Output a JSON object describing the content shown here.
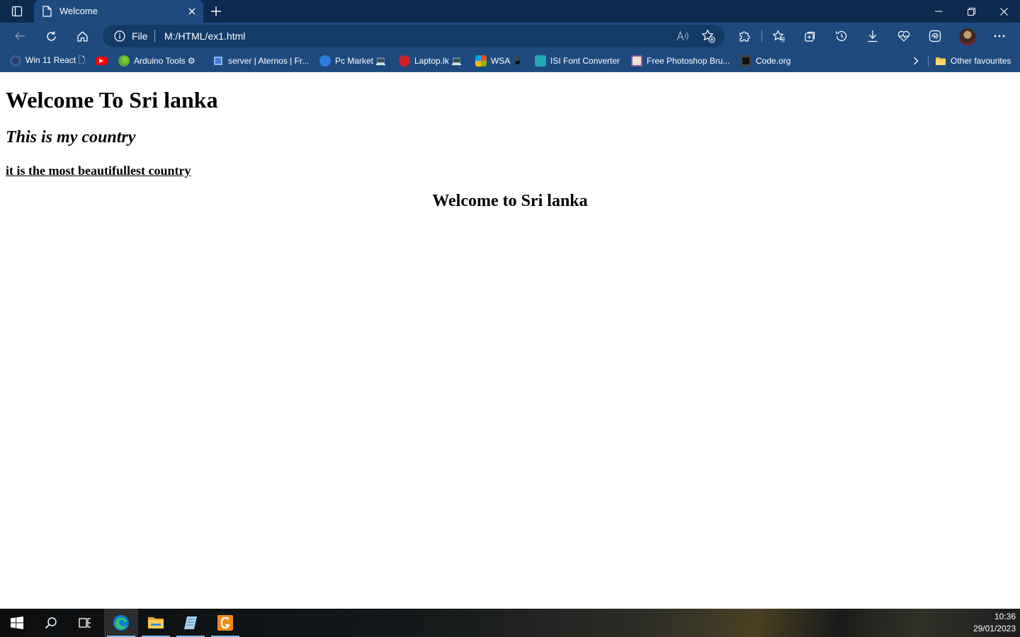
{
  "browser": {
    "tab": {
      "title": "Welcome",
      "favicon": "page-icon"
    },
    "address": {
      "scheme_label": "File",
      "url": "M:/HTML/ex1.html"
    },
    "colors": {
      "titlebar": "#0e2a4f",
      "toolbar": "#1f4a80",
      "address_bar": "#143a68"
    }
  },
  "bookmarks": {
    "items": [
      {
        "label": "Win 11 React 🗋",
        "icon": "react-icon",
        "color": "#2b3f6b"
      },
      {
        "label": "",
        "icon": "youtube-icon",
        "color": "#ff0000"
      },
      {
        "label": "Arduino Tools ⚙",
        "icon": "arduino-icon",
        "color": "#3aa33a"
      },
      {
        "label": "server | Aternos | Fr...",
        "icon": "aternos-icon",
        "color": "#3f7bd1"
      },
      {
        "label": "Pc Market 💻",
        "icon": "pcmarket-icon",
        "color": "#2d7de0"
      },
      {
        "label": "Laptop.lk 💻",
        "icon": "laptoplk-icon",
        "color": "#d1202a"
      },
      {
        "label": "WSA 📱",
        "icon": "wsa-icon",
        "color": "#f2a900"
      },
      {
        "label": "ISI Font Converter",
        "icon": "isi-icon",
        "color": "#22a8b7"
      },
      {
        "label": "Free Photoshop Bru...",
        "icon": "photoshop-icon",
        "color": "#e9e3d0"
      },
      {
        "label": "Code.org",
        "icon": "codeorg-icon",
        "color": "#111111"
      }
    ],
    "other_favourites": "Other favourites"
  },
  "page": {
    "heading1": "Welcome To Sri lanka",
    "heading2": "This is my country",
    "heading4": "it is the most beautifullest country",
    "heading_centered": "Welcome to Sri lanka"
  },
  "taskbar": {
    "apps": [
      "start-icon",
      "search-icon",
      "task-view-icon",
      "edge-icon",
      "file-explorer-icon",
      "notepad-icon",
      "orange-app-icon"
    ],
    "time": "10:36",
    "date": "29/01/2023"
  }
}
